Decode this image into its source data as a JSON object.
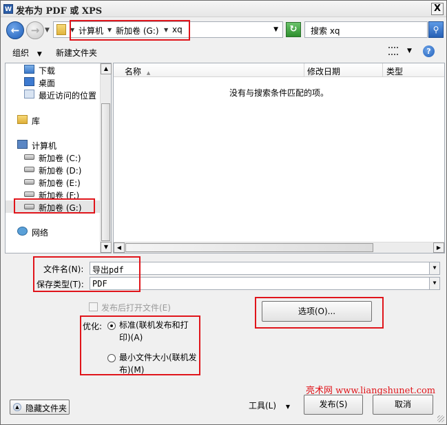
{
  "window": {
    "icon": "W",
    "title": "发布为 PDF 或 XPS",
    "close_glyph": "X"
  },
  "address": {
    "crumbs": [
      "计算机",
      "新加卷 (G:)",
      "xq"
    ],
    "search_value": "搜索 xq"
  },
  "toolbar": {
    "organize": "组织",
    "new_folder": "新建文件夹"
  },
  "nav": {
    "favorites": [
      "下载",
      "桌面",
      "最近访问的位置"
    ],
    "libraries": "库",
    "computer": "计算机",
    "drives": [
      "新加卷 (C:)",
      "新加卷 (D:)",
      "新加卷 (E:)",
      "新加卷 (F:)",
      "新加卷 (G:)"
    ],
    "network": "网络"
  },
  "filelist": {
    "columns": [
      "名称",
      "修改日期",
      "类型"
    ],
    "empty_message": "没有与搜索条件匹配的项。"
  },
  "form": {
    "filename_label": "文件名(N):",
    "filename_value": "导出pdf",
    "filetype_label": "保存类型(T):",
    "filetype_value": "PDF",
    "open_after_publish": "发布后打开文件(E)",
    "optimize_label": "优化:",
    "option_standard": "标准(联机发布和打印)(A)",
    "option_minimum": "最小文件大小(联机发布)(M)",
    "options_button": "选项(O)..."
  },
  "footer": {
    "hide_folders": "隐藏文件夹",
    "tools": "工具(L)",
    "publish": "发布(S)",
    "cancel": "取消"
  },
  "watermark": "亮术网 www.liangshunet.com",
  "colors": {
    "highlight_box": "#e0141a"
  },
  "icons": {
    "back": "←",
    "forward": "→",
    "refresh": "↻",
    "search": "⚲",
    "help": "?",
    "dropdown": "▼",
    "sort_up": "▲",
    "scroll_up": "▲",
    "scroll_down": "▼",
    "scroll_left": "◀",
    "scroll_right": "▶"
  }
}
